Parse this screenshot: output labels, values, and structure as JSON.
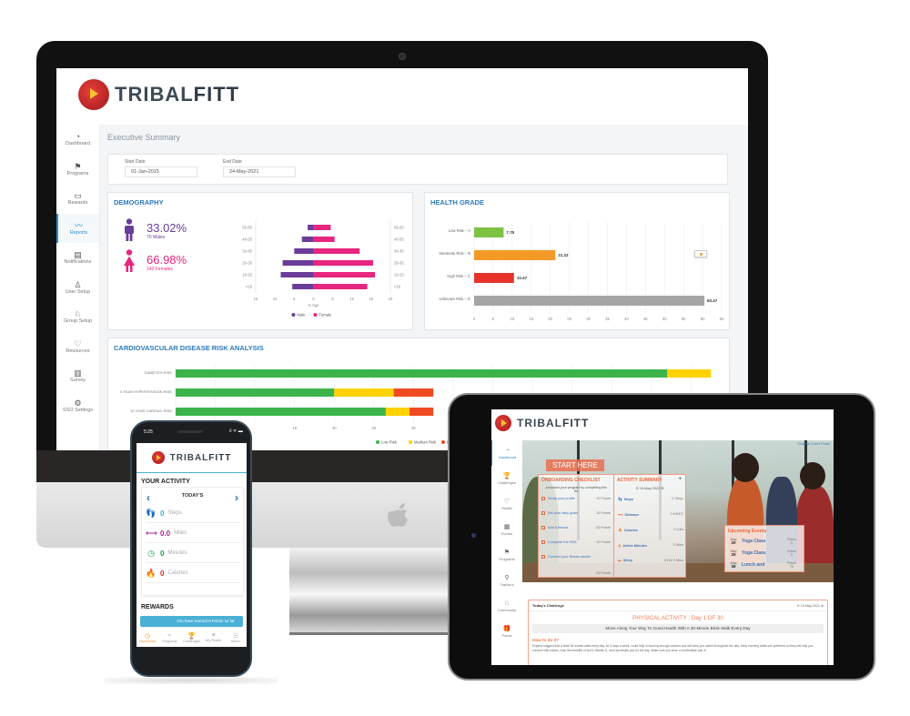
{
  "brand": {
    "name_light": "TRIBAL",
    "name_bold": "FITT",
    "colors": {
      "primary": "#2a7bbf",
      "accent": "#e9663e",
      "logo_red": "#c62a2a",
      "logo_yellow": "#f6c22e"
    }
  },
  "desktop": {
    "sidebar": [
      {
        "label": "Dashboard",
        "icon": "gauge-icon",
        "glyph": "◔",
        "active": false
      },
      {
        "label": "Programs",
        "icon": "flag-icon",
        "glyph": "⚑",
        "active": false
      },
      {
        "label": "Rewards",
        "icon": "card-icon",
        "glyph": "▭",
        "active": false
      },
      {
        "label": "Reports",
        "icon": "trend-icon",
        "glyph": "〰",
        "active": true
      },
      {
        "label": "Notifications",
        "icon": "notification-icon",
        "glyph": "▤",
        "active": false
      },
      {
        "label": "User Setup",
        "icon": "user-icon",
        "glyph": "♙",
        "active": false
      },
      {
        "label": "Group Setup",
        "icon": "group-icon",
        "glyph": "♘",
        "active": false
      },
      {
        "label": "Resources",
        "icon": "bulb-icon",
        "glyph": "♡",
        "active": false
      },
      {
        "label": "Survey",
        "icon": "bar-chart-icon",
        "glyph": "▥",
        "active": false
      },
      {
        "label": "SSO Settings",
        "icon": "gear-icon",
        "glyph": "⚙",
        "active": false
      }
    ],
    "page_title": "Executive Summary",
    "start_date": {
      "label": "Start Date",
      "value": "01-Jan-2015"
    },
    "end_date": {
      "label": "End Date",
      "value": "24-May-2021"
    },
    "demography": {
      "title": "DEMOGRAPHY",
      "male_pct": "33.02%",
      "male_count": "70 Males",
      "female_pct": "66.98%",
      "female_count": "142 Females"
    },
    "health_grade": {
      "title": "HEALTH GRADE"
    },
    "cardio": {
      "title": "CARDIOVASCULAR DISEASE RISK ANALYSIS"
    }
  },
  "chart_data": [
    {
      "type": "bar",
      "title": "DEMOGRAPHY",
      "orientation": "horizontal-pyramid",
      "categories": [
        "55-65",
        "46-55",
        "36-45",
        "26-35",
        "18-25",
        "<18"
      ],
      "series": [
        {
          "name": "Male",
          "color": "#6a3d9a",
          "values": [
            1.5,
            3,
            5,
            8,
            8.5,
            5.5
          ]
        },
        {
          "name": "Female",
          "color": "#e6267f",
          "values": [
            4.5,
            5.5,
            12,
            15.5,
            16,
            14
          ]
        }
      ],
      "xlabel": "% Age",
      "xticks": [
        "15",
        "10",
        "5",
        "0",
        "5",
        "10",
        "15",
        "20"
      ],
      "xlim": [
        -15,
        20
      ],
      "legend": "bottom"
    },
    {
      "type": "bar",
      "title": "HEALTH GRADE",
      "orientation": "horizontal",
      "categories": [
        "Low Risk – A",
        "Moderate Risk – B",
        "High Risk – C",
        "Unknown Risk – D"
      ],
      "values": [
        7.75,
        21.32,
        10.47,
        60.47
      ],
      "value_labels": [
        "7.75",
        "21.32",
        "10.47",
        "60.47"
      ],
      "colors": [
        "#7dc243",
        "#f39a26",
        "#e8332a",
        "#a5a5a5"
      ],
      "xticks": [
        "0",
        "5",
        "10",
        "15",
        "20",
        "25",
        "30",
        "35",
        "40",
        "45",
        "50",
        "55",
        "60",
        "65"
      ],
      "xlim": [
        0,
        65
      ],
      "grid": true
    },
    {
      "type": "bar",
      "title": "CARDIOVASCULAR DISEASE RISK ANALYSIS",
      "orientation": "horizontal-stacked",
      "categories": [
        "DIABETES RISK",
        "4 YEAR HYPERTENSION RISK",
        "10 YEAR CARDIAC RISK"
      ],
      "series": [
        {
          "name": "Low Risk",
          "color": "#3cb44b",
          "values": [
            62,
            20,
            26.5
          ]
        },
        {
          "name": "Medium Risk",
          "color": "#ffd200",
          "values": [
            5.5,
            7.5,
            3
          ]
        },
        {
          "name": "High Risk",
          "color": "#f04a23",
          "values": [
            0,
            5,
            3
          ]
        }
      ],
      "xticks": [
        "15",
        "20",
        "25",
        "30",
        "35",
        "40",
        "45",
        "50"
      ],
      "xlim": [
        0,
        70
      ],
      "legend": "bottom-right",
      "grid": true
    }
  ],
  "phone": {
    "time": "5:25",
    "status": "ıl ᯤ ▬",
    "activity_title": "YOUR ACTIVITY",
    "day_label": "TODAY'S",
    "metrics": [
      {
        "icon": "footsteps-icon",
        "glyph": "👣",
        "value": "0",
        "unit": "Steps",
        "color": "#2fb4e0"
      },
      {
        "icon": "distance-icon",
        "glyph": "⟷",
        "value": "0.0",
        "unit": "Miles",
        "color": "#b0208f"
      },
      {
        "icon": "timer-icon",
        "glyph": "◷",
        "value": "0",
        "unit": "Minutes",
        "color": "#1a9a4a"
      },
      {
        "icon": "flame-icon",
        "glyph": "🔥",
        "value": "0",
        "unit": "Calories",
        "color": "#d7262b"
      }
    ],
    "rewards_title": "REWARDS",
    "rewards_text": "You have earned 0 Points so far",
    "tabs": [
      {
        "label": "Dashboard",
        "glyph": "◷",
        "active": true
      },
      {
        "label": "Programs",
        "glyph": "⌖",
        "active": false
      },
      {
        "label": "Challenges",
        "glyph": "🏆",
        "active": false
      },
      {
        "label": "My Health",
        "glyph": "♥",
        "active": false
      },
      {
        "label": "Menu",
        "glyph": "☰",
        "active": false
      }
    ]
  },
  "tablet": {
    "sidebar": [
      {
        "label": "Dashboard",
        "glyph": "◔",
        "active": true
      },
      {
        "label": "Challenges",
        "glyph": "🏆",
        "active": false
      },
      {
        "label": "Health",
        "glyph": "♡",
        "active": false
      },
      {
        "label": "Events",
        "glyph": "▦",
        "active": false
      },
      {
        "label": "Programs",
        "glyph": "⚑",
        "active": false
      },
      {
        "label": "Trackers",
        "glyph": "⚲",
        "active": false
      },
      {
        "label": "Community",
        "glyph": "♘",
        "active": false
      },
      {
        "label": "Points",
        "glyph": "🎁",
        "active": false
      }
    ],
    "change_cover": "Change Cover Photo",
    "start_here": "START HERE",
    "onboarding": {
      "title": "ONBOARDING CHECKLIST",
      "subtitle": "Jumpstart your program by completing this list",
      "items": [
        {
          "label": "Setup your profile",
          "points": "10 Points"
        },
        {
          "label": "Set your daily goals",
          "points": "15 Points"
        },
        {
          "label": "Add 5 friends",
          "points": "25 Points"
        },
        {
          "label": "Complete the HRA",
          "points": "10 Points"
        },
        {
          "label": "Connect your fitness tracker",
          "points": ""
        }
      ],
      "footer_points": "25 Points"
    },
    "activity_summary": {
      "title": "ACTIVITY SUMMARY",
      "date": "19-May-2022",
      "rows": [
        {
          "name": "Steps",
          "value": "0 Steps",
          "glyph": "👣"
        },
        {
          "name": "Distance",
          "value": "0 MILES",
          "glyph": "⟷"
        },
        {
          "name": "Calories",
          "value": "0 Cals",
          "glyph": "🔥"
        },
        {
          "name": "Active Minutes",
          "value": "0 Mins",
          "glyph": "◷"
        },
        {
          "name": "Sleep",
          "value": "0 Hrs 0 Mins",
          "glyph": "▬"
        }
      ]
    },
    "events": {
      "title": "Upcoming Events",
      "items": [
        {
          "month": "May",
          "day": "20",
          "name": "Yoga Class",
          "pts_label": "Points",
          "pts": "5"
        },
        {
          "month": "May",
          "day": "25",
          "name": "Yoga Class",
          "pts_label": "Points",
          "pts": "5"
        },
        {
          "month": "May",
          "day": "36",
          "name": "Lunch and",
          "pts_label": "Points",
          "pts": "75"
        }
      ]
    },
    "challenge": {
      "header": "Today's Challenge",
      "date": "19-May-2021",
      "title": "PHYSICAL ACTIVITY : Day 1 OF 30",
      "subtitle": "Move Along Your Way To Good Health With A 30-Minute Brisk Walk Every Day",
      "how_title": "How to do it?",
      "body": "Experts suggest that a brisk 30-minute walk every day, for 5 days a week, could help in burning enough calories and will keep you active throughout the day. Early morning walks are preferred so they will help you connect with nature, reap the benefits of sun's Vitamin D, and rejuvenate you for the day. Make sure you wear a comfortable pair of"
    }
  }
}
